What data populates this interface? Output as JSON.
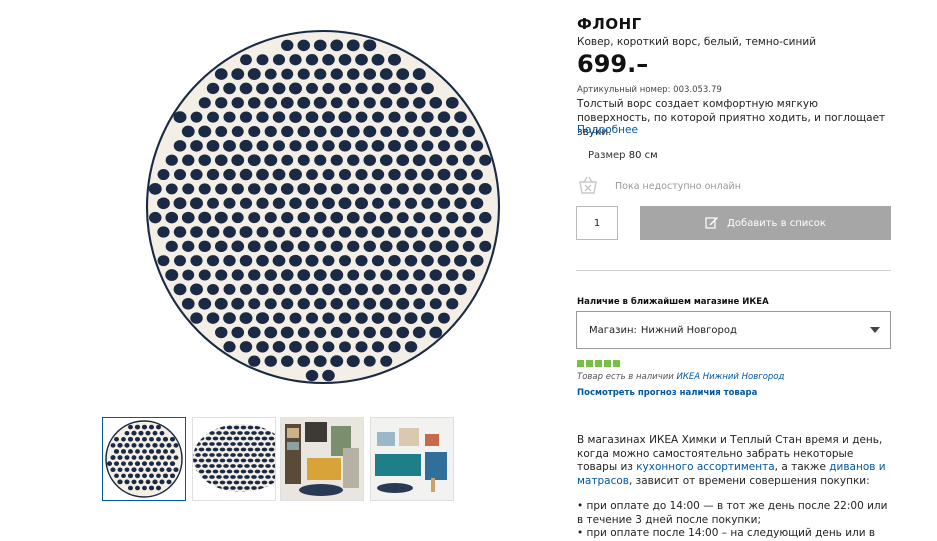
{
  "product": {
    "name": "ФЛОНГ",
    "subtitle": "Ковер, короткий ворс, белый, темно-синий",
    "price": "699.–",
    "article_label": "Артикульный номер:",
    "article_number": "003.053.79",
    "description": "Толстый ворс создает комфортную мягкую поверхность, по которой приятно ходить, и поглощает звуки.",
    "more_link": "Подробнее",
    "size_label": "Размер",
    "size_value": "80 см"
  },
  "purchase": {
    "online_status": "Пока недоступно онлайн",
    "quantity": "1",
    "add_to_list": "Добавить в список"
  },
  "availability": {
    "heading": "Наличие в ближайшем магазине ИКЕА",
    "store_label": "Магазин:",
    "store_value": "Нижний Новгород",
    "stock_level": 5,
    "stock_color": "#77c043",
    "in_stock_text": "Товар есть в наличии",
    "in_stock_store": "ИКЕА Нижний Новгород",
    "forecast_link": "Посмотреть прогноз наличия товара"
  },
  "pickup": {
    "p1": "В магазинах ИКЕА Химки и Теплый Стан время и день, когда можно самостоятельно забрать некоторые товары из",
    "link1": "кухонного ассортимента",
    "p2": ", а также",
    "link2": "диванов и матрасов",
    "p3": ", зависит от времени совершения покупки:",
    "b1": "• при оплате до 14:00 — в тот же день после 22:00 или в течение 3 дней после покупки;",
    "b2": "• при оплате после 14:00 – на следующий день или в"
  },
  "gallery": {
    "thumbnails": [
      "rug-top-view",
      "rug-angle-view",
      "living-room-scene",
      "teal-sideboard-scene"
    ],
    "active_index": 0
  },
  "colors": {
    "link": "#0058a3",
    "rug_dark": "#1b2a44",
    "rug_light": "#f3efe6",
    "button_disabled": "#a6a6a6"
  }
}
